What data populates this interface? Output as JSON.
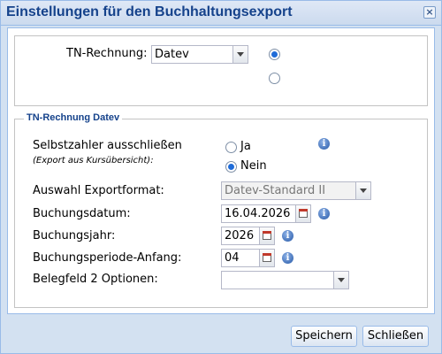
{
  "dialog": {
    "title": "Einstellungen für den Buchhaltungsexport",
    "close_symbol": "×"
  },
  "top": {
    "tn_label": "TN-Rechnung:",
    "tn_value": "Datev",
    "radio1_checked": true,
    "radio2_checked": false
  },
  "section": {
    "legend": "TN-Rechnung Datev",
    "selbst_label": "Selbstzahler ausschließen",
    "selbst_sub": "(Export aus Kursübersicht):",
    "ja_label": "Ja",
    "nein_label": "Nein",
    "ja_checked": false,
    "nein_checked": true,
    "format_label": "Auswahl Exportformat:",
    "format_value": "Datev-Standard II",
    "datum_label": "Buchungsdatum:",
    "datum_value": "16.04.2026",
    "jahr_label": "Buchungsjahr:",
    "jahr_value": "2026",
    "periode_label": "Buchungsperiode-Anfang:",
    "periode_value": "04",
    "beleg_label": "Belegfeld 2 Optionen:",
    "beleg_value": ""
  },
  "buttons": {
    "save": "Speichern",
    "close": "Schließen"
  },
  "icons": {
    "info": "i"
  }
}
